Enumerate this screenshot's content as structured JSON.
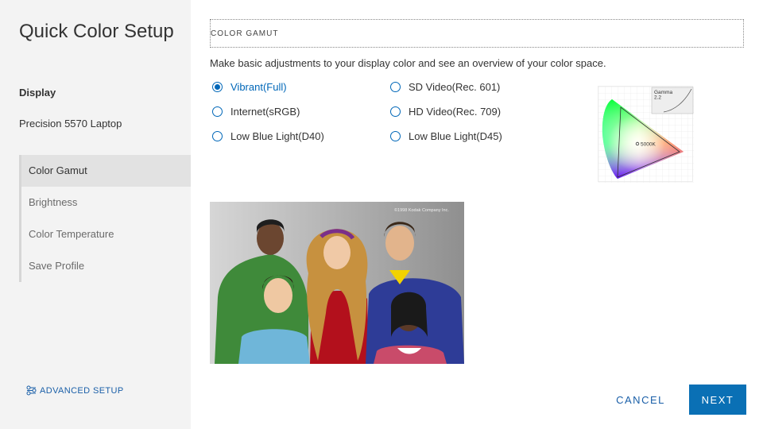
{
  "sidebar": {
    "app_title": "Quick Color Setup",
    "display_label": "Display",
    "display_value": "Precision 5570 Laptop",
    "steps": [
      {
        "label": "Color Gamut",
        "active": true
      },
      {
        "label": "Brightness",
        "active": false
      },
      {
        "label": "Color Temperature",
        "active": false
      },
      {
        "label": "Save Profile",
        "active": false
      }
    ],
    "advanced_label": "ADVANCED SETUP",
    "advanced_icon": "settings-nodes-icon"
  },
  "main": {
    "section_title": "COLOR GAMUT",
    "description": "Make basic adjustments to your display color and see an overview of your color space.",
    "options": [
      {
        "label": "Vibrant(Full)",
        "selected": true
      },
      {
        "label": "Internet(sRGB)",
        "selected": false
      },
      {
        "label": "Low Blue Light(D40)",
        "selected": false
      },
      {
        "label": "SD Video(Rec. 601)",
        "selected": false
      },
      {
        "label": "HD Video(Rec. 709)",
        "selected": false
      },
      {
        "label": "Low Blue Light(D45)",
        "selected": false
      }
    ],
    "gamut_chart": {
      "gamma_label": "Gamma",
      "gamma_value": "2.2",
      "whitepoint_label": "5000K"
    },
    "photo_caption": "©1998 Kodak Company Inc."
  },
  "footer": {
    "cancel_label": "CANCEL",
    "next_label": "NEXT"
  },
  "colors": {
    "accent": "#0067b8",
    "primary_button": "#0a70b5",
    "sidebar_bg": "#f3f3f3",
    "active_step_bg": "#e2e2e2"
  }
}
